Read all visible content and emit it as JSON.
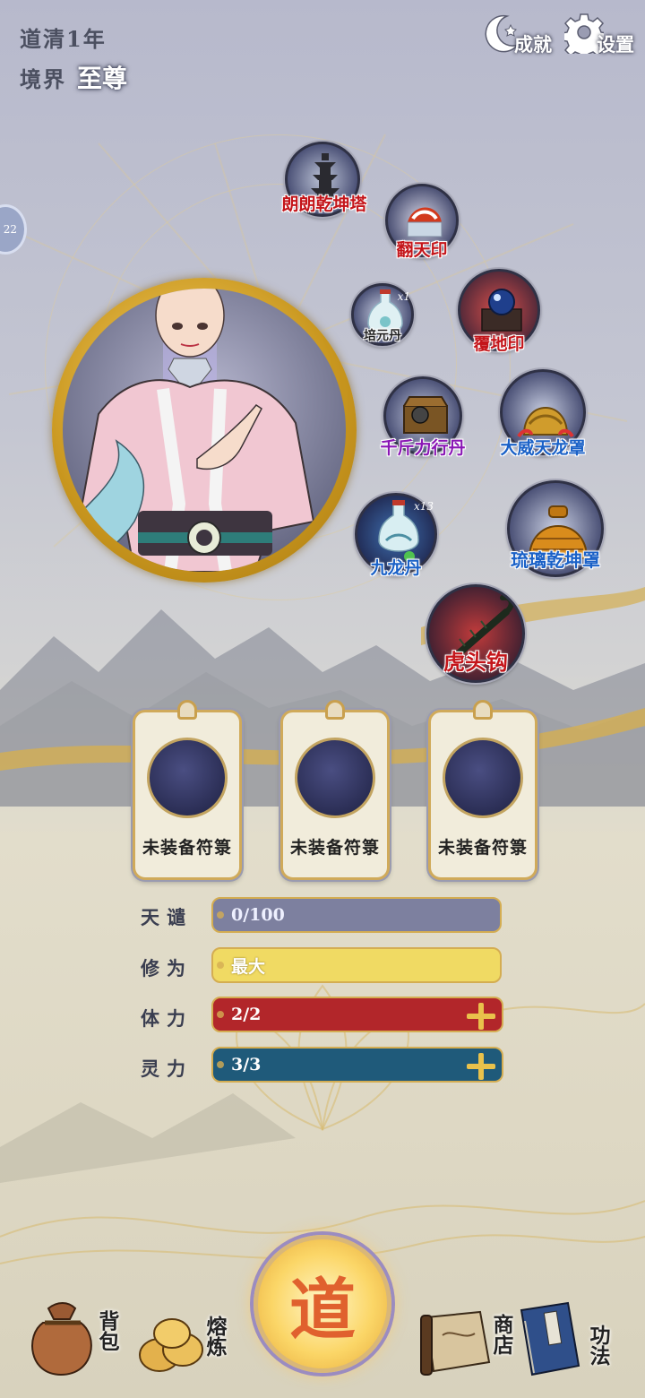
{
  "header": {
    "time_label": "道清1年",
    "realm_label": "境界",
    "realm_value": "至尊",
    "achievements_label": "成就",
    "settings_label": "设置",
    "side_tab_text": "22"
  },
  "treasures": [
    {
      "name": "朗朗乾坤塔",
      "color": "red"
    },
    {
      "name": "翻天印",
      "color": "red"
    },
    {
      "name": "培元丹",
      "count": "x1",
      "color": "black"
    },
    {
      "name": "覆地印",
      "color": "red"
    },
    {
      "name": "千斤力行丹",
      "color": "purple"
    },
    {
      "name": "大威天龙罩",
      "color": "blue"
    },
    {
      "name": "九龙丹",
      "count": "x13",
      "color": "blue"
    },
    {
      "name": "琉璃乾坤罩",
      "color": "blue"
    },
    {
      "name": "虎头钩",
      "color": "red"
    }
  ],
  "talisman_slots": [
    {
      "label": "未装备符箓"
    },
    {
      "label": "未装备符箓"
    },
    {
      "label": "未装备符箓"
    }
  ],
  "stats": {
    "tianqian": {
      "label": "天谴",
      "value": "0/100"
    },
    "xiuwei": {
      "label": "修为",
      "value": "最大"
    },
    "tili": {
      "label": "体力",
      "value": "2/2"
    },
    "lingli": {
      "label": "灵力",
      "value": "3/3"
    }
  },
  "nav": {
    "bag": "背包",
    "forge": "熔炼",
    "dao": "道",
    "shop": "商店",
    "skills": "功法"
  },
  "colors": {
    "tianqian_bar": "#7d809f",
    "xiuwei_bar": "#f0da63",
    "tili_bar": "#b2262a",
    "lingli_bar": "#1f5a7a",
    "gold_border": "#d4ad52"
  }
}
